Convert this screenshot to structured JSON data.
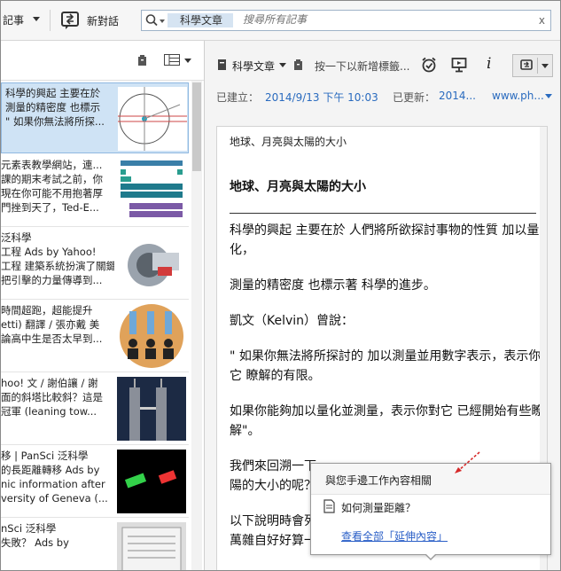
{
  "toolbar": {
    "note_label": "記事",
    "new_chat_label": "新對話",
    "search": {
      "token": "科學文章",
      "placeholder": "搜尋所有記事",
      "close": "x"
    }
  },
  "note_list": {
    "items": [
      {
        "lines": [
          "科學的興起 主要在於",
          "測量的精密度 也標示",
          "\" 如果你無法將所探..."
        ],
        "thumb": "circle-diagram",
        "selected": true
      },
      {
        "lines": [
          "元素表教學網站，連...",
          "課的期末考試之前，你",
          "現在你可能不用抱著厚",
          "門挫到天了，Ted-E..."
        ],
        "thumb": "periodic-table",
        "selected": false
      },
      {
        "lines": [
          "泛科學",
          "工程 Ads by Yahoo!",
          "工程 建築系統扮演了關鍵角",
          "把引擊的力量傳導到..."
        ],
        "thumb": "engine",
        "selected": false
      },
      {
        "lines": [
          "時間超跑，超能提升",
          "etti) 翻譯 / 張亦戴 美",
          "論高中生是否太早到..."
        ],
        "thumb": "silhouettes",
        "selected": false
      },
      {
        "lines": [
          "hoo! 文 / 謝伯讓 / 謝",
          "面的斜塔比較斜？這是",
          "冠軍 (leaning tow..."
        ],
        "thumb": "towers",
        "selected": false
      },
      {
        "lines": [
          "移 | PanSci 泛科學",
          "的長距離轉移 Ads by",
          "nic information after",
          "versity of Geneva (..."
        ],
        "thumb": "laser",
        "selected": false
      },
      {
        "lines": [
          "nSci 泛科學",
          "失敗？ Ads by"
        ],
        "thumb": "newspaper",
        "selected": false
      }
    ]
  },
  "note_view": {
    "notebook": "科學文章",
    "tag_placeholder": "按一下以新增標籤...",
    "created_label": "已建立：",
    "created_value": "2014/9/13 下午 10:03",
    "updated_label": "已更新：",
    "updated_value": "2014...",
    "source_value": "www.ph...",
    "info_glyph": "i",
    "doc": {
      "header": "地球、月亮與太陽的大小",
      "title": "地球、月亮與太陽的大小",
      "paragraphs": [
        [
          "科學的興起 主要在於 人們將所欲探討事物的性質 加以量",
          "化，"
        ],
        [
          "測量的精密度 也標示著 科學的進步。"
        ],
        [
          "凱文（Kelvin）曾說："
        ],
        [
          "\" 如果你無法將所探討的 加以測量並用數字表示，表示你對",
          "它 瞭解的有限。"
        ],
        [
          "如果你能夠加以量化並測量，表示你對它 已經開始有些瞭",
          "解\"。"
        ],
        [
          "我們來回溯一下",
          "陽的大小的呢？"
        ],
        [
          "以下說明時會列",
          "萬雜自好好算一"
        ]
      ]
    }
  },
  "popup": {
    "title": "與您手邊工作內容相關",
    "item": "如何測量距離？",
    "link": "查看全部「延伸內容」"
  }
}
